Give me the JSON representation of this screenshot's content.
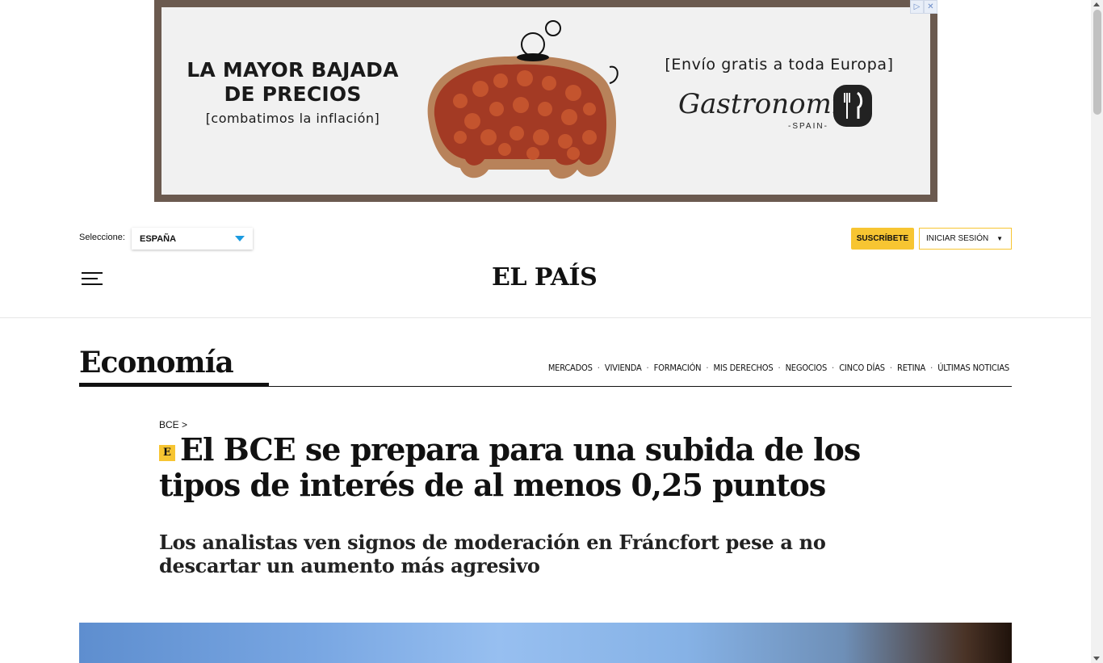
{
  "ad": {
    "headline_line1": "LA MAYOR BAJADA",
    "headline_line2": "DE PRECIOS",
    "subline": "[combatimos la inflación]",
    "shipping": "[Envío gratis a toda Europa]",
    "brand_name": "Gastronomic",
    "brand_country": "-SPAIN-",
    "adchoices_icon": "adchoices-icon",
    "close_icon": "close-icon"
  },
  "header": {
    "edition_label": "Seleccione:",
    "edition_value": "ESPAÑA",
    "subscribe_label": "SUSCRÍBETE",
    "login_label": "INICIAR SESIÓN",
    "login_caret": "▼",
    "logo": "EL PAÍS",
    "menu_icon": "hamburger-icon"
  },
  "section": {
    "title": "Economía",
    "nav": [
      "MERCADOS",
      "VIVIENDA",
      "FORMACIÓN",
      "MIS DERECHOS",
      "NEGOCIOS",
      "CINCO DÍAS",
      "RETINA",
      "ÚLTIMAS NOTICIAS"
    ]
  },
  "article": {
    "kicker": "BCE >",
    "exclusive_badge": "E",
    "headline": "El BCE se prepara para una subida de los tipos de interés de al menos 0,25 puntos",
    "subtitle": "Los analistas ven signos de moderación en Fráncfort pese a no descartar un aumento más agresivo"
  },
  "colors": {
    "accent_yellow": "#f7c532",
    "select_arrow": "#1b9be0",
    "ad_frame": "#6b5a4f"
  }
}
